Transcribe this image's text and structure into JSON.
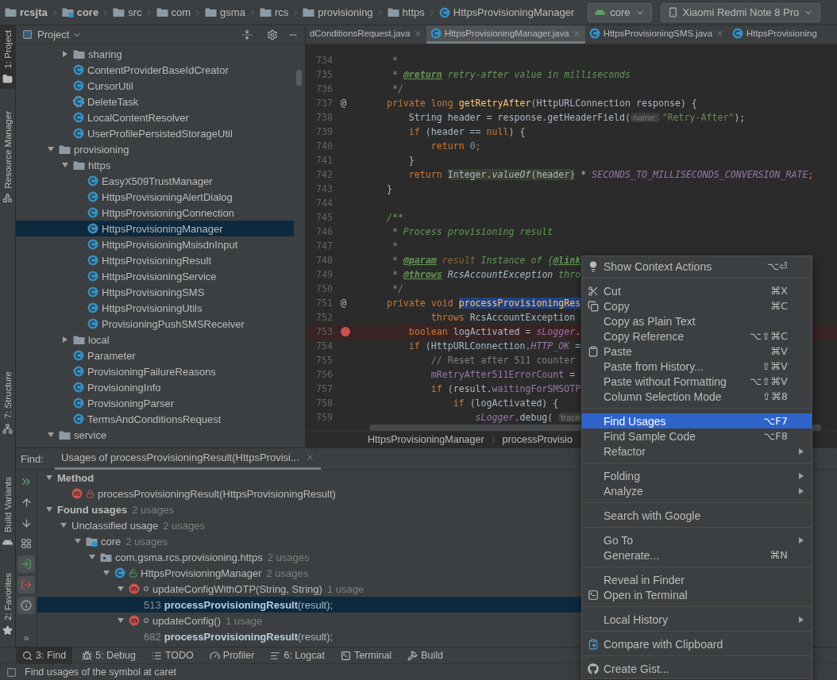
{
  "navbar": {
    "crumbs": [
      {
        "label": "rcsjta",
        "kind": "project"
      },
      {
        "label": "core",
        "kind": "module"
      },
      {
        "label": "src",
        "kind": "folder"
      },
      {
        "label": "com",
        "kind": "folder"
      },
      {
        "label": "gsma",
        "kind": "folder"
      },
      {
        "label": "rcs",
        "kind": "folder"
      },
      {
        "label": "provisioning",
        "kind": "folder"
      },
      {
        "label": "https",
        "kind": "folder"
      },
      {
        "label": "HttpsProvisioningManager",
        "kind": "class"
      }
    ],
    "config": "core",
    "device": "Xiaomi Redmi Note 8 Pro"
  },
  "tool_strip": {
    "top": [
      {
        "label": "1: Project",
        "kind": "project",
        "selected": true
      },
      {
        "label": "Resource Manager",
        "kind": "resources",
        "selected": false
      }
    ],
    "bottom": [
      {
        "label": "7: Structure",
        "kind": "structure",
        "selected": false
      },
      {
        "label": "Build Variants",
        "kind": "variants",
        "selected": false
      },
      {
        "label": "2: Favorites",
        "kind": "favorites",
        "selected": false
      }
    ]
  },
  "project": {
    "title": "Project",
    "tree": [
      {
        "children": [
          {
            "kind": "folder",
            "label": "sharing",
            "expanded": false,
            "selected": false
          },
          {
            "kind": "class",
            "label": "ContentProviderBaseIdCreator",
            "selected": false
          },
          {
            "kind": "class",
            "label": "CursorUtil",
            "selected": false
          },
          {
            "kind": "abstract",
            "label": "DeleteTask",
            "selected": false
          },
          {
            "kind": "class",
            "label": "LocalContentResolver",
            "selected": false
          },
          {
            "kind": "class",
            "label": "UserProfilePersistedStorageUtil",
            "selected": false
          }
        ]
      },
      {
        "kind": "folder",
        "label": "provisioning",
        "expanded": true,
        "selected": false,
        "children": [
          {
            "kind": "folder",
            "label": "https",
            "expanded": true,
            "selected": false,
            "children": [
              {
                "kind": "class",
                "label": "EasyX509TrustManager",
                "selected": false
              },
              {
                "kind": "class",
                "label": "HttpsProvisioningAlertDialog",
                "selected": false
              },
              {
                "kind": "class",
                "label": "HttpsProvisioningConnection",
                "selected": false
              },
              {
                "kind": "class",
                "label": "HttpsProvisioningManager",
                "selected": true
              },
              {
                "kind": "class",
                "label": "HttpsProvisioningMsisdnInput",
                "selected": false
              },
              {
                "kind": "class",
                "label": "HttpsProvisioningResult",
                "selected": false
              },
              {
                "kind": "class",
                "label": "HttpsProvisioningService",
                "selected": false
              },
              {
                "kind": "class",
                "label": "HttpsProvisioningSMS",
                "selected": false
              },
              {
                "kind": "class",
                "label": "HttpsProvisioningUtils",
                "selected": false
              },
              {
                "kind": "class",
                "label": "ProvisioningPushSMSReceiver",
                "selected": false
              }
            ]
          },
          {
            "kind": "folder",
            "label": "local",
            "expanded": false,
            "selected": false
          },
          {
            "kind": "class",
            "label": "Parameter",
            "selected": false
          },
          {
            "kind": "class",
            "label": "ProvisioningFailureReasons",
            "selected": false
          },
          {
            "kind": "class",
            "label": "ProvisioningInfo",
            "selected": false
          },
          {
            "kind": "class",
            "label": "ProvisioningParser",
            "selected": false
          },
          {
            "kind": "class",
            "label": "TermsAndConditionsRequest",
            "selected": false
          }
        ]
      },
      {
        "kind": "folder",
        "label": "service",
        "expanded": true,
        "selected": false
      }
    ]
  },
  "editor": {
    "tabs": [
      {
        "label": "dConditionsRequest.java",
        "kind": "clipped",
        "selected": false
      },
      {
        "label": "HttpsProvisioningManager.java",
        "kind": "class",
        "selected": true
      },
      {
        "label": "HttpsProvisioningSMS.java",
        "kind": "class",
        "selected": false
      },
      {
        "label": "HttpsProvisioning",
        "kind": "class",
        "selected": false
      }
    ],
    "lines": [
      {
        "number": "734",
        "tokens": [
          {
            "kind": "doc",
            "text": "     *"
          }
        ]
      },
      {
        "number": "735",
        "tokens": [
          {
            "kind": "doc",
            "text": "     * "
          },
          {
            "kind": "tag",
            "text": "@return"
          },
          {
            "kind": "doc",
            "text": " retry-after value in milliseconds"
          }
        ]
      },
      {
        "number": "736",
        "tokens": [
          {
            "kind": "doc",
            "text": "     */"
          }
        ]
      },
      {
        "number": "737",
        "gutter": {
          "kind": "override",
          "symbol": "@"
        },
        "tokens": [
          {
            "kind": "kw",
            "text": "    private long "
          },
          {
            "kind": "fn",
            "text": "getRetryAfter"
          },
          {
            "kind": "p",
            "text": "(HttpURLConnection response) {"
          }
        ]
      },
      {
        "number": "738",
        "tokens": [
          {
            "kind": "p",
            "text": "        String header = response.getHeaderField("
          },
          {
            "kind": "hint",
            "text": "name:"
          },
          {
            "kind": "str",
            "text": "\"Retry-After\""
          },
          {
            "kind": "p",
            "text": ");"
          }
        ]
      },
      {
        "number": "739",
        "tokens": [
          {
            "kind": "kw",
            "text": "        if "
          },
          {
            "kind": "p",
            "text": "(header == "
          },
          {
            "kind": "kw",
            "text": "null"
          },
          {
            "kind": "p",
            "text": ") {"
          }
        ]
      },
      {
        "number": "740",
        "tokens": [
          {
            "kind": "kw",
            "text": "            return "
          },
          {
            "kind": "num",
            "text": "0"
          },
          {
            "kind": "kw",
            "text": ";"
          }
        ]
      },
      {
        "number": "741",
        "tokens": [
          {
            "kind": "p",
            "text": "        }"
          }
        ]
      },
      {
        "number": "742",
        "tokens": [
          {
            "kind": "kw",
            "text": "        return "
          },
          {
            "kind": "hl",
            "text": "Integer."
          },
          {
            "kind": "hlcall",
            "text": "valueOf"
          },
          {
            "kind": "hl",
            "text": "(header)"
          },
          {
            "kind": "p",
            "text": " * "
          },
          {
            "kind": "fld",
            "text": "SECONDS_TO_MILLISECONDS_CONVERSION_RATE"
          },
          {
            "kind": "kw",
            "text": ";"
          }
        ]
      },
      {
        "number": "743",
        "tokens": [
          {
            "kind": "p",
            "text": "    }"
          }
        ]
      },
      {
        "number": "744"
      },
      {
        "number": "745",
        "tokens": [
          {
            "kind": "doc",
            "text": "    /**"
          }
        ]
      },
      {
        "number": "746",
        "tokens": [
          {
            "kind": "doc",
            "text": "     * Process provisioning result"
          }
        ]
      },
      {
        "number": "747",
        "tokens": [
          {
            "kind": "doc",
            "text": "     *"
          }
        ]
      },
      {
        "number": "748",
        "tokens": [
          {
            "kind": "doc",
            "text": "     * "
          },
          {
            "kind": "tag",
            "text": "@param"
          },
          {
            "kind": "param",
            "text": " result"
          },
          {
            "kind": "doc",
            "text": " Instance of {"
          },
          {
            "kind": "tag",
            "text": "@link"
          }
        ]
      },
      {
        "number": "749",
        "tokens": [
          {
            "kind": "doc",
            "text": "     * "
          },
          {
            "kind": "tag",
            "text": "@throws"
          },
          {
            "kind": "docref",
            "text": " RcsAccountException"
          },
          {
            "kind": "doc",
            "text": " thro"
          }
        ]
      },
      {
        "number": "750",
        "tokens": [
          {
            "kind": "doc",
            "text": "     */"
          }
        ]
      },
      {
        "number": "751",
        "gutter": {
          "kind": "override",
          "symbol": "@"
        },
        "tokens": [
          {
            "kind": "kw",
            "text": "    private void "
          },
          {
            "kind": "sel",
            "text": "processProvisioningRes"
          }
        ]
      },
      {
        "number": "752",
        "tokens": [
          {
            "kind": "kw",
            "text": "            throws "
          },
          {
            "kind": "p",
            "text": "RcsAccountException"
          }
        ]
      },
      {
        "number": "753",
        "gutter": {
          "kind": "breakpoint"
        },
        "tokens": [
          {
            "kind": "kw",
            "text": "        boolean "
          },
          {
            "kind": "p",
            "text": "logActivated = "
          },
          {
            "kind": "fld",
            "text": "sLogger"
          },
          {
            "kind": "p",
            "text": "."
          }
        ]
      },
      {
        "number": "754",
        "tokens": [
          {
            "kind": "kw",
            "text": "        if "
          },
          {
            "kind": "p",
            "text": "(HttpURLConnection."
          },
          {
            "kind": "fld",
            "text": "HTTP_OK"
          },
          {
            "kind": "p",
            "text": " ="
          }
        ]
      },
      {
        "number": "755",
        "tokens": [
          {
            "kind": "cm",
            "text": "            // Reset after 511 counter"
          }
        ]
      },
      {
        "number": "756",
        "tokens": [
          {
            "kind": "field",
            "text": "            mRetryAfter511ErrorCount"
          },
          {
            "kind": "p",
            "text": " ="
          }
        ]
      },
      {
        "number": "757",
        "tokens": [
          {
            "kind": "kw",
            "text": "            if "
          },
          {
            "kind": "p",
            "text": "(result."
          },
          {
            "kind": "field",
            "text": "waitingForSMSOTP"
          }
        ]
      },
      {
        "number": "758",
        "tokens": [
          {
            "kind": "kw",
            "text": "                if "
          },
          {
            "kind": "p",
            "text": "(logActivated) {"
          }
        ]
      },
      {
        "number": "759",
        "tokens": [
          {
            "kind": "fld",
            "text": "                    sLogger"
          },
          {
            "kind": "p",
            "text": ".debug( "
          },
          {
            "kind": "hint",
            "text": "trace"
          }
        ]
      }
    ],
    "breadcrumbs": [
      "HttpsProvisioningManager",
      "processProvisio"
    ]
  },
  "find": {
    "label": "Find:",
    "tab": "Usages of processProvisioningResult(HttpsProvisi...",
    "tools": [
      {
        "kind": "rerun",
        "on": false
      },
      {
        "kind": "up",
        "on": false
      },
      {
        "kind": "down",
        "on": false
      },
      {
        "kind": "group",
        "on": false
      },
      {
        "kind": "import",
        "on": true
      },
      {
        "kind": "export",
        "on": true
      },
      {
        "kind": "info",
        "on": true
      }
    ],
    "more": "»",
    "results": [
      {
        "kind": "heading",
        "label": "Method",
        "expanded": true,
        "selected": false,
        "children": [
          {
            "kind": "method",
            "locked": true,
            "label": "processProvisioningResult(HttpsProvisioningResult)",
            "selected": false
          }
        ]
      },
      {
        "kind": "heading",
        "label": "Found usages",
        "count": "2 usages",
        "expanded": true,
        "selected": false,
        "children": [
          {
            "kind": "group",
            "label": "Unclassified usage",
            "count": "2 usages",
            "expanded": true,
            "selected": false,
            "children": [
              {
                "kind": "module",
                "label": "core",
                "count": "2 usages",
                "expanded": true,
                "selected": false,
                "children": [
                  {
                    "kind": "package",
                    "label": "com.gsma.rcs.provisioning.https",
                    "count": "2 usages",
                    "expanded": true,
                    "selected": false,
                    "children": [
                      {
                        "kind": "class",
                        "unlocked": true,
                        "label": "HttpsProvisioningManager",
                        "count": "2 usages",
                        "expanded": true,
                        "selected": false,
                        "children": [
                          {
                            "kind": "method",
                            "package_private": true,
                            "label": "updateConfigWithOTP(String, String)",
                            "count": "1 usage",
                            "expanded": true,
                            "selected": false,
                            "children": [
                              {
                                "kind": "usage",
                                "line": "513",
                                "code": "**processProvisioningResult**(result);",
                                "selected": true
                              }
                            ]
                          },
                          {
                            "kind": "method",
                            "package_private": true,
                            "label": "updateConfig()",
                            "count": "1 usage",
                            "expanded": true,
                            "selected": false,
                            "children": [
                              {
                                "kind": "usage",
                                "line": "682",
                                "code": "**processProvisioningResult**(result);",
                                "selected": false
                              }
                            ]
                          }
                        ]
                      }
                    ]
                  }
                ]
              }
            ]
          }
        ]
      }
    ]
  },
  "bottom_tools": [
    {
      "label": "3: Find",
      "kind": "find",
      "selected": true
    },
    {
      "label": "5: Debug",
      "kind": "debug",
      "selected": false
    },
    {
      "label": "TODO",
      "kind": "todo",
      "selected": false
    },
    {
      "label": "Profiler",
      "kind": "profiler",
      "selected": false
    },
    {
      "label": "6: Logcat",
      "kind": "logcat",
      "selected": false
    },
    {
      "label": "Terminal",
      "kind": "terminal",
      "selected": false
    },
    {
      "label": "Build",
      "kind": "build",
      "selected": false
    }
  ],
  "status_bar": "Find usages of the symbol at caret",
  "context_menu": {
    "groups": [
      [
        {
          "label": "Show Context Actions",
          "shortcut": "⌥⏎",
          "kind": "bulb",
          "submenu": false,
          "selected": false
        }
      ],
      [
        {
          "label": "Cut",
          "shortcut": "⌘X",
          "kind": "cut",
          "submenu": false,
          "selected": false
        },
        {
          "label": "Copy",
          "shortcut": "⌘C",
          "kind": "copy",
          "submenu": false,
          "selected": false
        },
        {
          "label": "Copy as Plain Text",
          "kind": "plain",
          "submenu": false,
          "selected": false
        },
        {
          "label": "Copy Reference",
          "shortcut": "⌥⇧⌘C",
          "kind": "plain",
          "submenu": false,
          "selected": false
        },
        {
          "label": "Paste",
          "shortcut": "⌘V",
          "kind": "paste",
          "submenu": false,
          "selected": false
        },
        {
          "label": "Paste from History...",
          "shortcut": "⇧⌘V",
          "kind": "plain",
          "submenu": false,
          "selected": false
        },
        {
          "label": "Paste without Formatting",
          "shortcut": "⌥⇧⌘V",
          "kind": "plain",
          "submenu": false,
          "selected": false
        },
        {
          "label": "Column Selection Mode",
          "shortcut": "⇧⌘8",
          "kind": "plain",
          "submenu": false,
          "selected": false
        }
      ],
      [
        {
          "label": "Find Usages",
          "shortcut": "⌥F7",
          "kind": "plain",
          "submenu": false,
          "selected": true
        },
        {
          "label": "Find Sample Code",
          "shortcut": "⌥F8",
          "kind": "plain",
          "submenu": false,
          "selected": false
        },
        {
          "label": "Refactor",
          "kind": "plain",
          "submenu": true,
          "selected": false
        }
      ],
      [
        {
          "label": "Folding",
          "kind": "plain",
          "submenu": true,
          "selected": false
        },
        {
          "label": "Analyze",
          "kind": "plain",
          "submenu": true,
          "selected": false
        }
      ],
      [
        {
          "label": "Search with Google",
          "kind": "plain",
          "submenu": false,
          "selected": false
        }
      ],
      [
        {
          "label": "Go To",
          "kind": "plain",
          "submenu": true,
          "selected": false
        },
        {
          "label": "Generate...",
          "shortcut": "⌘N",
          "kind": "plain",
          "submenu": false,
          "selected": false
        }
      ],
      [
        {
          "label": "Reveal in Finder",
          "kind": "plain",
          "submenu": false,
          "selected": false
        },
        {
          "label": "Open in Terminal",
          "kind": "terminal",
          "submenu": false,
          "selected": false
        }
      ],
      [
        {
          "label": "Local History",
          "kind": "plain",
          "submenu": true,
          "selected": false
        }
      ],
      [
        {
          "label": "Compare with Clipboard",
          "kind": "compare",
          "submenu": false,
          "selected": false
        }
      ],
      [
        {
          "label": "Create Gist...",
          "kind": "gist",
          "submenu": false,
          "selected": false
        }
      ]
    ]
  }
}
